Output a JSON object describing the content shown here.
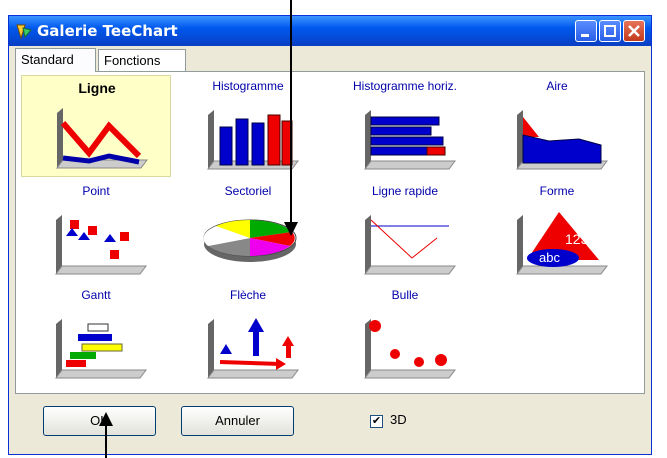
{
  "window": {
    "title": "Galerie TeeChart"
  },
  "tabs": [
    {
      "label": "Standard",
      "active": true
    },
    {
      "label": "Fonctions",
      "active": false
    }
  ],
  "gallery": [
    {
      "label": "Ligne",
      "icon": "line-chart-icon",
      "selected": true
    },
    {
      "label": "Histogramme",
      "icon": "bar-chart-icon"
    },
    {
      "label": "Histogramme horiz.",
      "icon": "horizontal-bar-chart-icon"
    },
    {
      "label": "Aire",
      "icon": "area-chart-icon"
    },
    {
      "label": "Point",
      "icon": "point-chart-icon"
    },
    {
      "label": "Sectoriel",
      "icon": "pie-chart-icon"
    },
    {
      "label": "Ligne rapide",
      "icon": "fast-line-chart-icon"
    },
    {
      "label": "Forme",
      "icon": "shape-chart-icon",
      "shape_text": [
        "123",
        "abc"
      ]
    },
    {
      "label": "Gantt",
      "icon": "gantt-chart-icon"
    },
    {
      "label": "Flèche",
      "icon": "arrow-chart-icon"
    },
    {
      "label": "Bulle",
      "icon": "bubble-chart-icon"
    }
  ],
  "buttons": {
    "ok": "OK",
    "cancel": "Annuler"
  },
  "checkbox": {
    "label": "3D",
    "checked": true,
    "mark": "✔"
  },
  "colors": {
    "titlebar": "#0058ee",
    "label": "#0000aa",
    "selected_bg": "#ffffc8"
  }
}
